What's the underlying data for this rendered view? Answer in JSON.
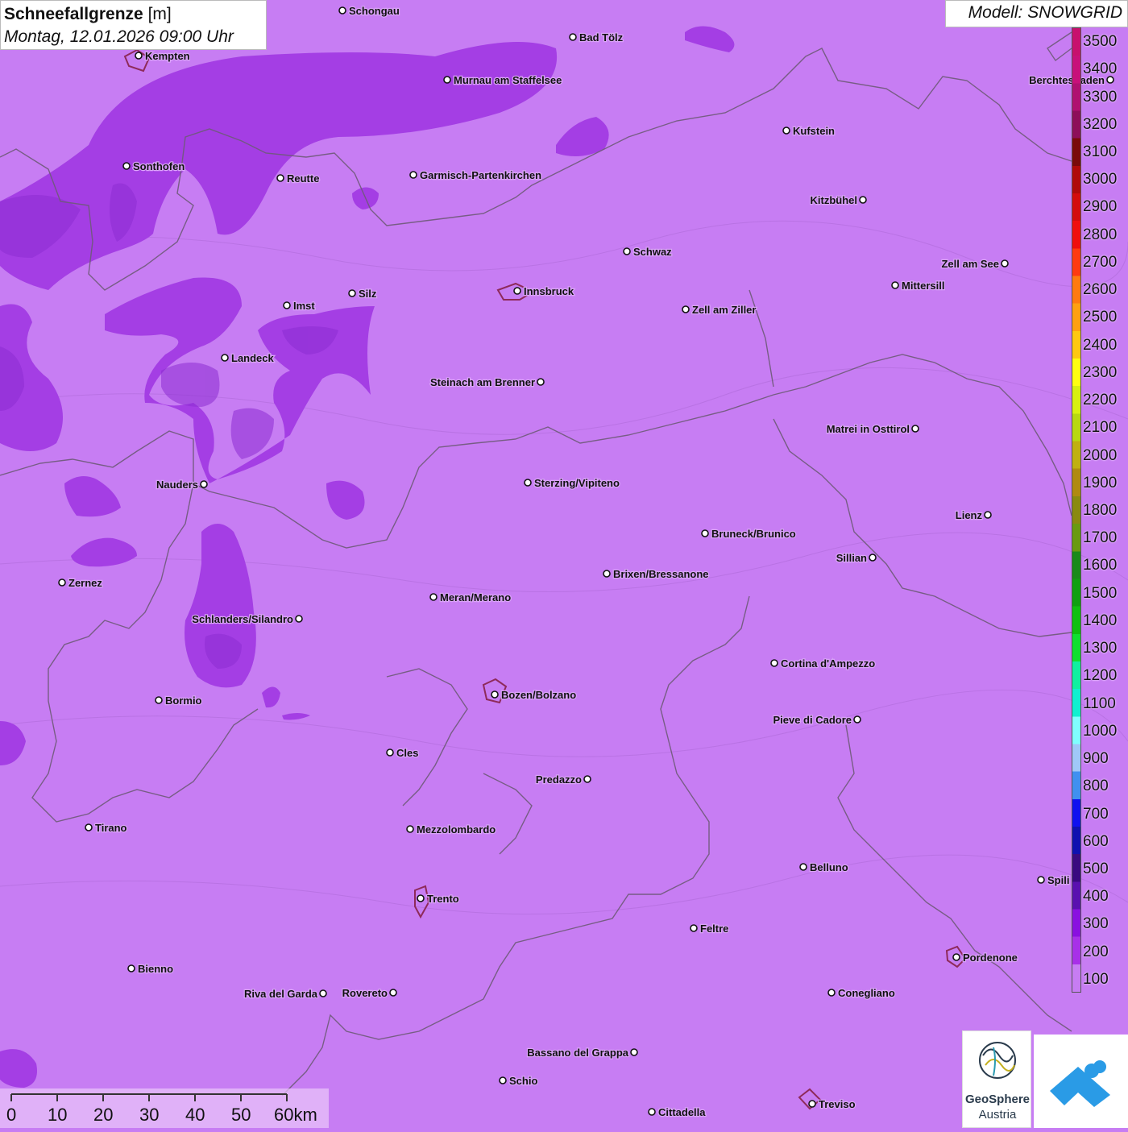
{
  "title": {
    "main": "Schneefallgrenze",
    "unit": "[m]",
    "datetime": "Montag, 12.01.2026 09:00 Uhr"
  },
  "model": "Modell: SNOWGRID",
  "legend": {
    "labels": [
      "3500",
      "3400",
      "3300",
      "3200",
      "3100",
      "3000",
      "2900",
      "2800",
      "2700",
      "2600",
      "2500",
      "2400",
      "2300",
      "2200",
      "2100",
      "2000",
      "1900",
      "1800",
      "1700",
      "1600",
      "1500",
      "1400",
      "1300",
      "1200",
      "1100",
      "1000",
      "900",
      "800",
      "700",
      "600",
      "500",
      "400",
      "300",
      "200",
      "100"
    ],
    "colors": [
      "#c8106e",
      "#c8107a",
      "#b01070",
      "#8e0e5a",
      "#7a0a0a",
      "#b00a0a",
      "#d40c0c",
      "#f00e0e",
      "#ff3a10",
      "#ff7a10",
      "#ffa010",
      "#ffc810",
      "#ffff10",
      "#d8f010",
      "#b8d810",
      "#c0b010",
      "#b08a10",
      "#8a8a10",
      "#6a9a10",
      "#1a8a1a",
      "#10a010",
      "#10c010",
      "#10e030",
      "#10f0a0",
      "#10f0d0",
      "#80ffff",
      "#a0c8f8",
      "#4090f0",
      "#1010f0",
      "#1010b0",
      "#3a0a80",
      "#5a10b0",
      "#8a10e0",
      "#a830e8",
      "#c77df3"
    ]
  },
  "cities": [
    {
      "name": "Schongau"
    },
    {
      "name": "Bad Tölz"
    },
    {
      "name": "Kempten"
    },
    {
      "name": "Murnau am Staffelsee"
    },
    {
      "name": "Berchtesgaden"
    },
    {
      "name": "Kufstein"
    },
    {
      "name": "Sonthofen"
    },
    {
      "name": "Reutte"
    },
    {
      "name": "Garmisch-Partenkirchen"
    },
    {
      "name": "Kitzbühel"
    },
    {
      "name": "Schwaz"
    },
    {
      "name": "Zell am See"
    },
    {
      "name": "Mittersill"
    },
    {
      "name": "Innsbruck"
    },
    {
      "name": "Silz"
    },
    {
      "name": "Imst"
    },
    {
      "name": "Zell am Ziller"
    },
    {
      "name": "Landeck"
    },
    {
      "name": "Steinach am Brenner"
    },
    {
      "name": "Matrei in Osttirol"
    },
    {
      "name": "Nauders"
    },
    {
      "name": "Sterzing/Vipiteno"
    },
    {
      "name": "Lienz"
    },
    {
      "name": "Bruneck/Brunico"
    },
    {
      "name": "Sillian"
    },
    {
      "name": "Zernez"
    },
    {
      "name": "Brixen/Bressanone"
    },
    {
      "name": "Meran/Merano"
    },
    {
      "name": "Schlanders/Silandro"
    },
    {
      "name": "Cortina d'Ampezzo"
    },
    {
      "name": "Bozen/Bolzano"
    },
    {
      "name": "Bormio"
    },
    {
      "name": "Pieve di Cadore"
    },
    {
      "name": "Cles"
    },
    {
      "name": "Predazzo"
    },
    {
      "name": "Tirano"
    },
    {
      "name": "Mezzolombardo"
    },
    {
      "name": "Belluno"
    },
    {
      "name": "Trento"
    },
    {
      "name": "Feltre"
    },
    {
      "name": "Pordenone"
    },
    {
      "name": "Bienno"
    },
    {
      "name": "Riva del Garda"
    },
    {
      "name": "Rovereto"
    },
    {
      "name": "Conegliano"
    },
    {
      "name": "Bassano del Grappa"
    },
    {
      "name": "Schio"
    },
    {
      "name": "Treviso"
    },
    {
      "name": "Cittadella"
    },
    {
      "name": "Spili"
    }
  ],
  "scalebar": {
    "ticks": [
      "0",
      "10",
      "20",
      "30",
      "40",
      "50",
      "60km"
    ]
  },
  "logos": {
    "geosphere_line1": "GeoSphere",
    "geosphere_line2": "Austria"
  },
  "colors": {
    "base_field": "#c77df3",
    "low_field": "#a838e6",
    "lowest_field": "#8c1cd6",
    "border": "#6e5a78"
  }
}
